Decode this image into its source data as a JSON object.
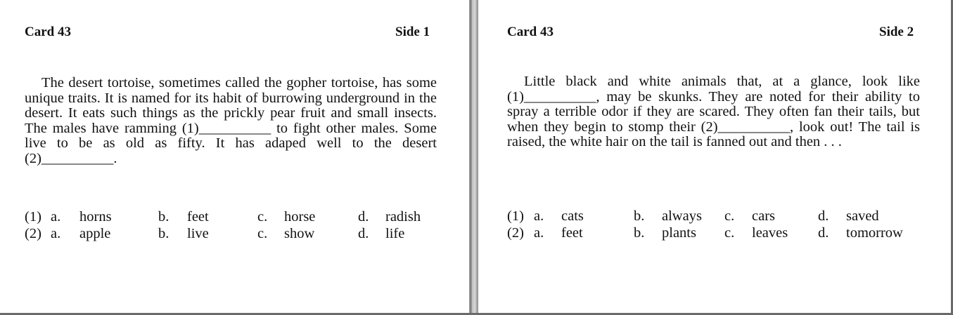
{
  "cards": [
    {
      "card_label": "Card 43",
      "side_label": "Side 1",
      "passage": "The desert tortoise, sometimes called the gopher tortoise, has some unique traits. It is named for its habit of burrowing underground in the desert. It eats such things as the prickly pear fruit and small insects. The males have ramming (1)__________ to fight other males. Some live to be as old as fifty. It has adaped well to the desert (2)__________.",
      "choices": [
        {
          "num": "(1)",
          "a_letter": "a.",
          "a": "horns",
          "b_letter": "b.",
          "b": "feet",
          "c_letter": "c.",
          "c": "horse",
          "d_letter": "d.",
          "d": "radish"
        },
        {
          "num": "(2)",
          "a_letter": "a.",
          "a": "apple",
          "b_letter": "b.",
          "b": "live",
          "c_letter": "c.",
          "c": "show",
          "d_letter": "d.",
          "d": "life"
        }
      ]
    },
    {
      "card_label": "Card 43",
      "side_label": "Side 2",
      "passage": "Little black and white animals that, at a glance, look like (1)__________, may be skunks. They are noted for their ability to spray a terrible odor if they are scared. They often fan their tails, but when they begin to stomp their (2)__________, look out! The tail is raised, the white hair on the tail is fanned out and then . . .",
      "choices": [
        {
          "num": "(1)",
          "a_letter": "a.",
          "a": "cats",
          "b_letter": "b.",
          "b": "always",
          "c_letter": "c.",
          "c": "cars",
          "d_letter": "d.",
          "d": "saved"
        },
        {
          "num": "(2)",
          "a_letter": "a.",
          "a": "feet",
          "b_letter": "b.",
          "b": "plants",
          "c_letter": "c.",
          "c": "leaves",
          "d_letter": "d.",
          "d": "tomorrow"
        }
      ]
    }
  ]
}
